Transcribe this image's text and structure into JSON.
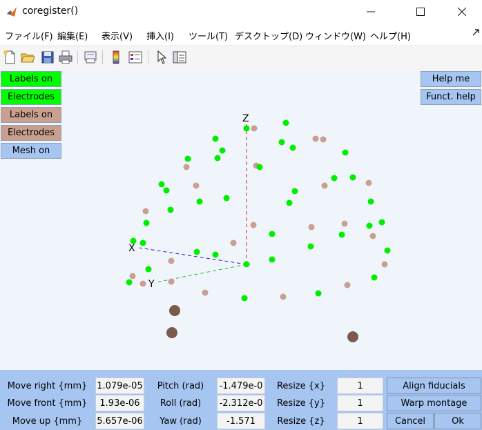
{
  "window": {
    "title": "coregister()"
  },
  "menu": [
    "ファイル(F)",
    "編集(E)",
    "表示(V)",
    "挿入(I)",
    "ツール(T)",
    "デスクトップ(D)",
    "ウィンドウ(W)",
    "ヘルプ(H)"
  ],
  "toolbar": [
    "new-file-icon",
    "open-folder-icon",
    "save-icon",
    "print-icon",
    "print-preview-icon",
    "colorbar-icon",
    "legend-icon",
    "pointer-icon",
    "property-editor-icon"
  ],
  "left_buttons": [
    {
      "label": "Labels on",
      "color": "#00ff00"
    },
    {
      "label": "Electrodes",
      "color": "#00ff00"
    },
    {
      "label": "Labels on",
      "color": "#c9a090"
    },
    {
      "label": "Electrodes",
      "color": "#c9a090"
    },
    {
      "label": "Mesh on",
      "color": "#a7c5f1"
    }
  ],
  "right_buttons": [
    "Help me",
    "Funct. help"
  ],
  "axes": {
    "x": "X",
    "y": "Y",
    "z": "Z"
  },
  "colors": {
    "green": "#00ee00",
    "tan": "#c9a090",
    "fiducial": "#7b5a4e"
  },
  "controls": {
    "rows": [
      {
        "move_label": "Move right {mm}",
        "move_value": "1.079e-05",
        "rot_label": "Pitch (rad)",
        "rot_value": "-1.479e-0",
        "resize_label": "Resize {x}",
        "resize_value": "1"
      },
      {
        "move_label": "Move front {mm}",
        "move_value": "1.93e-06",
        "rot_label": "Roll (rad)",
        "rot_value": "-2.312e-0",
        "resize_label": "Resize {y}",
        "resize_value": "1"
      },
      {
        "move_label": "Move up {mm}",
        "move_value": "5.657e-06",
        "rot_label": "Yaw (rad)",
        "rot_value": "-1.571",
        "resize_label": "Resize {z}",
        "resize_value": "1"
      }
    ],
    "align_fiducials": "Align fiducials",
    "warp_montage": "Warp montage",
    "cancel": "Cancel",
    "ok": "Ok"
  }
}
